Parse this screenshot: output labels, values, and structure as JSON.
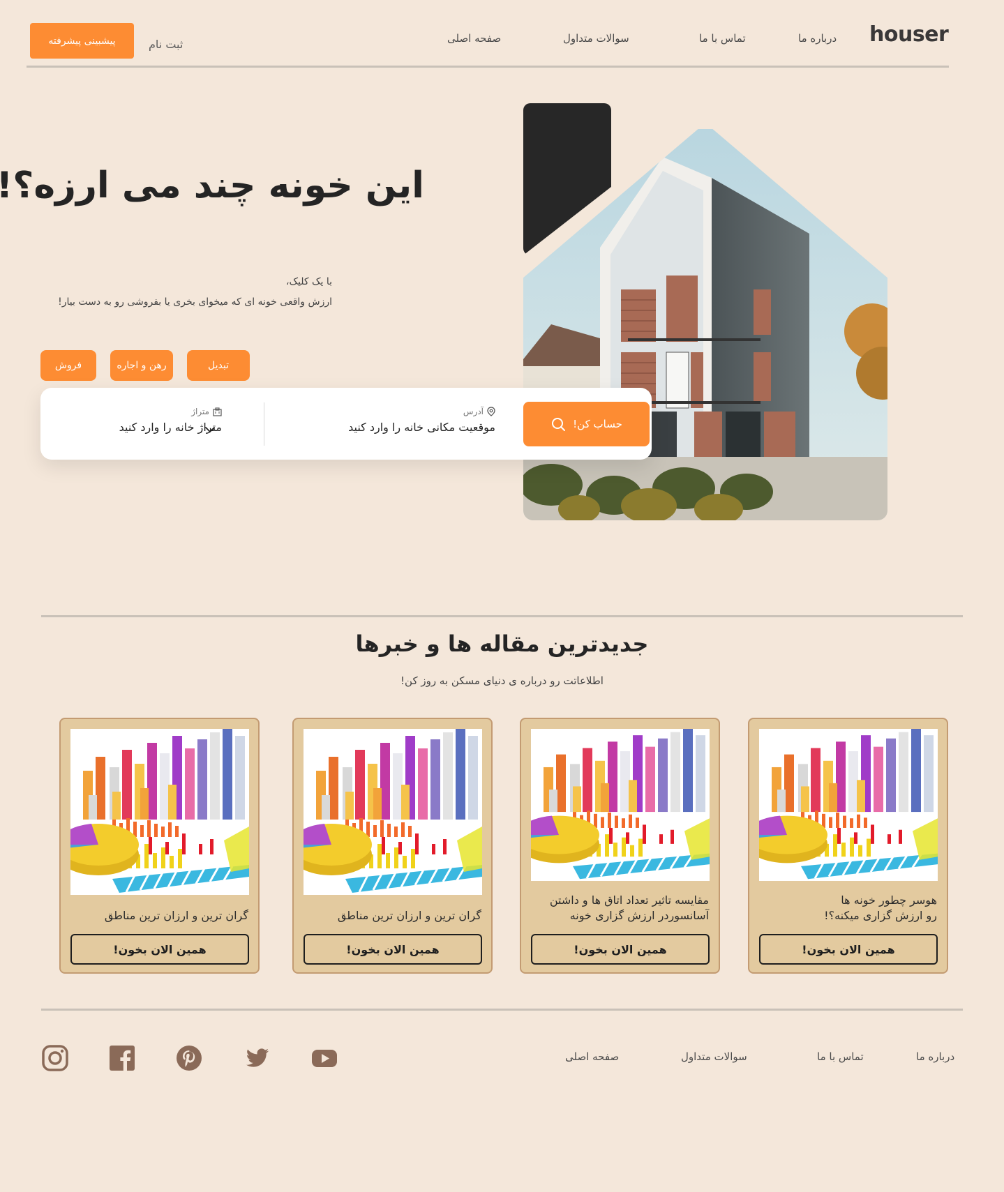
{
  "header": {
    "logo": "houser",
    "nav": [
      "درباره ما",
      "تماس با ما",
      "سوالات متداول",
      "صفحه اصلی"
    ],
    "signup": "ثبت نام",
    "advanced_prediction": "پیشبینی پیشرفته"
  },
  "hero": {
    "title": "این خونه چند می ارزه؟!",
    "subtitle_line1": "با یک کلیک،",
    "subtitle_line2": "ارزش واقعی خونه ای که میخوای بخری یا بفروشی رو به دست بیار!",
    "pills": [
      "تبدیل",
      "رهن و اجاره",
      "فروش"
    ]
  },
  "search": {
    "calc_button": "حساب کن!",
    "address_label": "آدرس",
    "address_placeholder": "موقعیت مکانی خانه را وارد کنید",
    "area_label": "متراژ",
    "area_placeholder": "متراژ خانه را وارد کنید"
  },
  "articles": {
    "title": "جدیدترین مقاله ها و خبرها",
    "subtitle": "اطلاعاتت رو درباره ی دنیای مسکن به روز کن!",
    "cards": [
      {
        "title_line1": "هوسر چطور خونه ها",
        "title_line2": "رو ارزش گزاری میکنه؟!",
        "button": "همین الان بخون!"
      },
      {
        "title_line1": "مقایسه تاثیر تعداد اتاق ها و داشتن",
        "title_line2": "آسانسوردر ارزش گزاری خونه",
        "button": "همین الان بخون!"
      },
      {
        "title_line1": "گران ترین و ارزان ترین مناطق",
        "title_line2": "",
        "button": "همین الان بخون!"
      },
      {
        "title_line1": "گران ترین و ارزان ترین مناطق",
        "title_line2": "",
        "button": "همین الان بخون!"
      }
    ]
  },
  "footer": {
    "links": [
      "درباره ما",
      "تماس با ما",
      "سوالات متداول",
      "صفحه اصلی"
    ],
    "social": [
      "youtube-icon",
      "twitter-icon",
      "pinterest-icon",
      "facebook-icon",
      "instagram-icon"
    ]
  },
  "colors": {
    "background": "#f4e7da",
    "accent": "#fd8c33",
    "card": "#e3ca9f",
    "card_border": "#c39b72",
    "icon": "#8a6a58"
  }
}
